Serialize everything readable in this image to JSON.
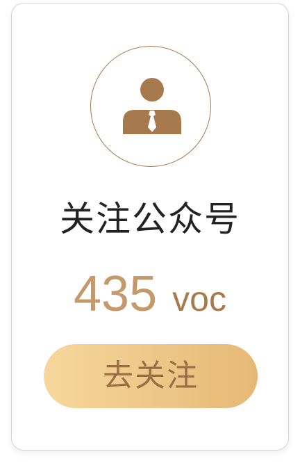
{
  "card": {
    "icon": "person-with-tie-icon",
    "title": "关注公众号",
    "reward": {
      "amount": "435",
      "unit": "voc"
    },
    "button_label": "去关注"
  },
  "colors": {
    "accent_brown": "#a77a4d",
    "amount_color": "#c49a6c",
    "button_gradient_start": "#f6d79c",
    "button_gradient_end": "#e6b875",
    "button_text": "#9b6d45",
    "title_text": "#222222"
  }
}
